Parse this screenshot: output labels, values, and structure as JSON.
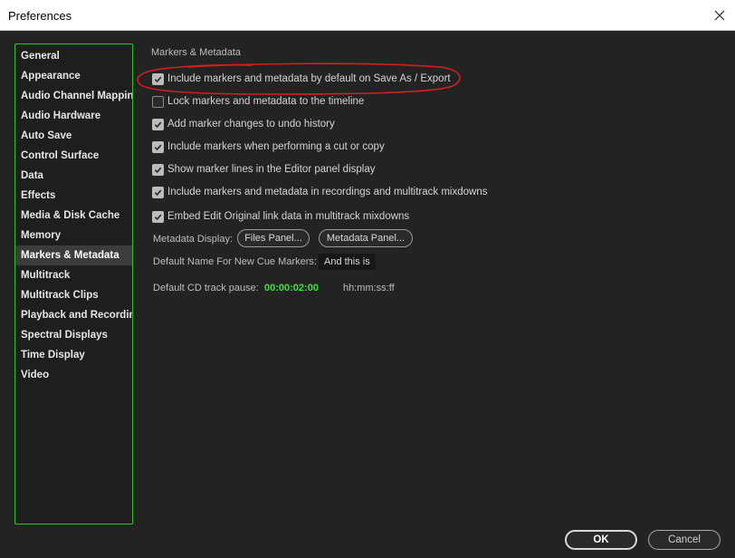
{
  "window": {
    "title": "Preferences"
  },
  "sidebar": {
    "items": [
      {
        "label": "General"
      },
      {
        "label": "Appearance"
      },
      {
        "label": "Audio Channel Mapping"
      },
      {
        "label": "Audio Hardware"
      },
      {
        "label": "Auto Save"
      },
      {
        "label": "Control Surface"
      },
      {
        "label": "Data"
      },
      {
        "label": "Effects"
      },
      {
        "label": "Media & Disk Cache"
      },
      {
        "label": "Memory"
      },
      {
        "label": "Markers & Metadata",
        "selected": true
      },
      {
        "label": "Multitrack"
      },
      {
        "label": "Multitrack Clips"
      },
      {
        "label": "Playback and Recording"
      },
      {
        "label": "Spectral Displays"
      },
      {
        "label": "Time Display"
      },
      {
        "label": "Video"
      }
    ],
    "border_color": "#2ec02e"
  },
  "main": {
    "section_title": "Markers & Metadata",
    "options": [
      {
        "label": "Include markers and metadata by default on Save As / Export",
        "checked": true
      },
      {
        "label": "Lock markers and metadata to the timeline",
        "checked": false
      },
      {
        "label": "Add marker changes to undo history",
        "checked": true
      },
      {
        "label": "Include markers when performing a cut or copy",
        "checked": true
      },
      {
        "label": "Show marker lines in the Editor panel display",
        "checked": true
      },
      {
        "label": "Include markers and metadata in recordings and multitrack mixdowns",
        "checked": true
      },
      {
        "label": "Embed Edit Original link data in multitrack mixdowns",
        "checked": true
      }
    ],
    "metadata_display": {
      "label": "Metadata Display:",
      "files_panel_button": "Files Panel...",
      "metadata_panel_button": "Metadata Panel..."
    },
    "cue_marker": {
      "label": "Default Name For New Cue Markers:",
      "value": "And this is"
    },
    "cd_pause": {
      "label": "Default CD track pause:",
      "value": "00:00:02:00",
      "format": "hh:mm:ss:ff",
      "value_color": "#3ee03e"
    }
  },
  "footer": {
    "ok_label": "OK",
    "cancel_label": "Cancel"
  },
  "annotation": {
    "color": "#d61f1f"
  }
}
